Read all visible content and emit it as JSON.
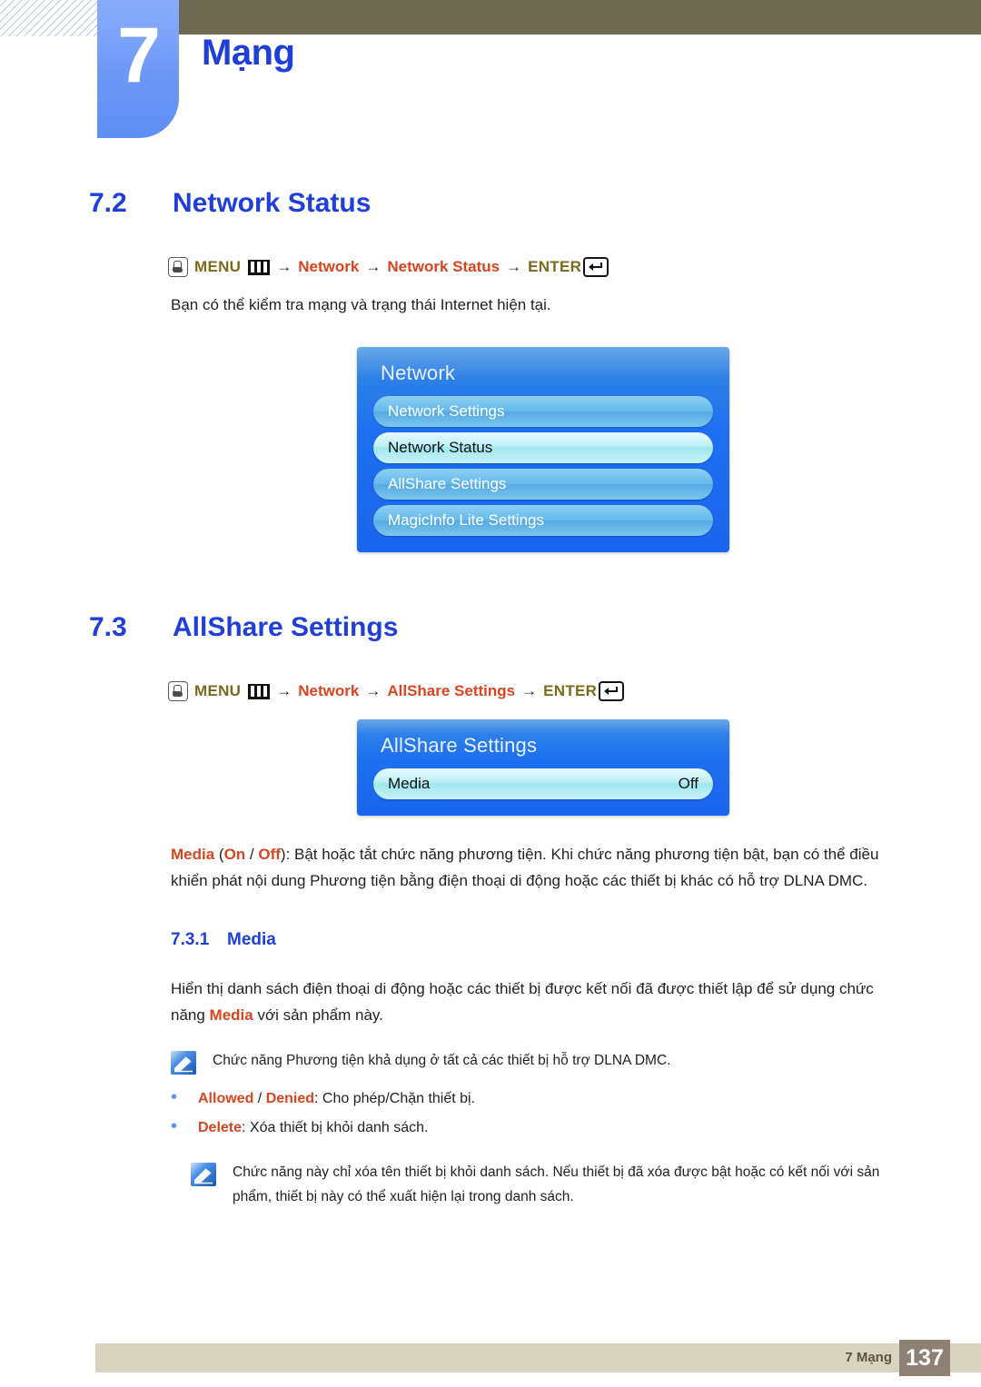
{
  "header": {
    "chapter_number": "7",
    "chapter_title": "Mạng",
    "hatch_icon": "diagonal-hatch-pattern",
    "accent_blue": "#5f8ef5",
    "olive_bar_color": "#6e6a52",
    "heading_blue": "#1f3fd8"
  },
  "sections": {
    "network_status": {
      "number": "7.2",
      "title": "Network Status",
      "navpath": {
        "hand_icon": "hand-press-button-icon",
        "menu_label": "MENU",
        "menu_icon": "menu-bars-icon",
        "arrow": "→",
        "step1": "Network",
        "step2": "Network Status",
        "enter_label": "ENTER",
        "enter_icon": "enter-key-icon"
      },
      "description": "Bạn có thể kiểm tra mạng và trạng thái Internet hiện tại.",
      "osd": {
        "title": "Network",
        "rows": [
          {
            "label": "Network Settings",
            "value": "",
            "selected": false
          },
          {
            "label": "Network Status",
            "value": "",
            "selected": true
          },
          {
            "label": "AllShare Settings",
            "value": "",
            "selected": false
          },
          {
            "label": "MagicInfo Lite Settings",
            "value": "",
            "selected": false
          }
        ]
      }
    },
    "allshare_settings": {
      "number": "7.3",
      "title": "AllShare Settings",
      "navpath": {
        "hand_icon": "hand-press-button-icon",
        "menu_label": "MENU",
        "menu_icon": "menu-bars-icon",
        "arrow": "→",
        "step1": "Network",
        "step2": "AllShare Settings",
        "enter_label": "ENTER",
        "enter_icon": "enter-key-icon"
      },
      "osd": {
        "title": "AllShare Settings",
        "rows": [
          {
            "label": "Media",
            "value": "Off",
            "selected": true
          }
        ]
      },
      "body": {
        "em1": "Media",
        "paren_open": " (",
        "em2": "On",
        "slash": " / ",
        "em3": "Off",
        "rest": "): Bật hoặc tắt chức năng phương tiện. Khi chức năng phương tiện bật, bạn có thể điều khiển phát nội dung Phương tiện bằng điện thoại di động hoặc các thiết bị khác có hỗ trợ DLNA DMC."
      }
    },
    "media": {
      "number": "7.3.1",
      "title": "Media",
      "body_part1": "Hiển thị danh sách điện thoại di động hoặc các thiết bị được kết nối đã được thiết lập để sử dụng chức năng ",
      "body_em": "Media",
      "body_part2": " với sản phẩm này.",
      "note1": {
        "icon": "note-pen-icon",
        "text": "Chức năng Phương tiện khả dụng ở tất cả các thiết bị hỗ trợ DLNA DMC."
      },
      "bullets": [
        {
          "dot": "•",
          "em1": "Allowed",
          "slash": " / ",
          "em2": "Denied",
          "rest": ": Cho phép/Chặn thiết bị."
        },
        {
          "dot": "•",
          "em1": "Delete",
          "slash": "",
          "em2": "",
          "rest": ": Xóa thiết bị khỏi danh sách."
        }
      ],
      "note2": {
        "icon": "note-pen-icon",
        "text": "Chức năng này chỉ xóa tên thiết bị khỏi danh sách. Nếu thiết bị đã xóa được bật hoặc có kết nối với sản phẩm, thiết bị này có thể xuất hiện lại trong danh sách."
      }
    }
  },
  "footer": {
    "label": "7 Mạng",
    "page_number": "137",
    "bar_color": "#d9d4c0",
    "page_box_color": "#8d8075"
  }
}
